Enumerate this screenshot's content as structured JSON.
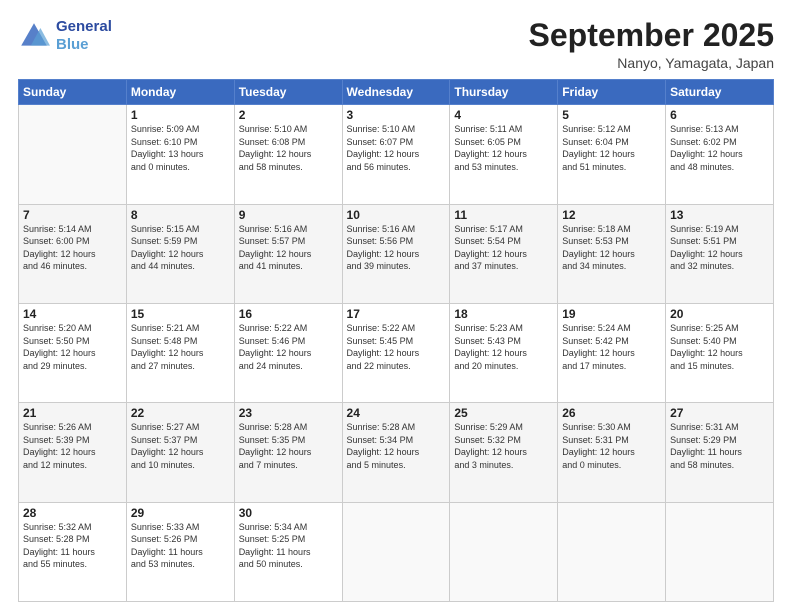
{
  "header": {
    "logo_line1": "General",
    "logo_line2": "Blue",
    "month": "September 2025",
    "location": "Nanyo, Yamagata, Japan"
  },
  "weekdays": [
    "Sunday",
    "Monday",
    "Tuesday",
    "Wednesday",
    "Thursday",
    "Friday",
    "Saturday"
  ],
  "rows": [
    [
      {
        "day": "",
        "info": ""
      },
      {
        "day": "1",
        "info": "Sunrise: 5:09 AM\nSunset: 6:10 PM\nDaylight: 13 hours\nand 0 minutes."
      },
      {
        "day": "2",
        "info": "Sunrise: 5:10 AM\nSunset: 6:08 PM\nDaylight: 12 hours\nand 58 minutes."
      },
      {
        "day": "3",
        "info": "Sunrise: 5:10 AM\nSunset: 6:07 PM\nDaylight: 12 hours\nand 56 minutes."
      },
      {
        "day": "4",
        "info": "Sunrise: 5:11 AM\nSunset: 6:05 PM\nDaylight: 12 hours\nand 53 minutes."
      },
      {
        "day": "5",
        "info": "Sunrise: 5:12 AM\nSunset: 6:04 PM\nDaylight: 12 hours\nand 51 minutes."
      },
      {
        "day": "6",
        "info": "Sunrise: 5:13 AM\nSunset: 6:02 PM\nDaylight: 12 hours\nand 48 minutes."
      }
    ],
    [
      {
        "day": "7",
        "info": "Sunrise: 5:14 AM\nSunset: 6:00 PM\nDaylight: 12 hours\nand 46 minutes."
      },
      {
        "day": "8",
        "info": "Sunrise: 5:15 AM\nSunset: 5:59 PM\nDaylight: 12 hours\nand 44 minutes."
      },
      {
        "day": "9",
        "info": "Sunrise: 5:16 AM\nSunset: 5:57 PM\nDaylight: 12 hours\nand 41 minutes."
      },
      {
        "day": "10",
        "info": "Sunrise: 5:16 AM\nSunset: 5:56 PM\nDaylight: 12 hours\nand 39 minutes."
      },
      {
        "day": "11",
        "info": "Sunrise: 5:17 AM\nSunset: 5:54 PM\nDaylight: 12 hours\nand 37 minutes."
      },
      {
        "day": "12",
        "info": "Sunrise: 5:18 AM\nSunset: 5:53 PM\nDaylight: 12 hours\nand 34 minutes."
      },
      {
        "day": "13",
        "info": "Sunrise: 5:19 AM\nSunset: 5:51 PM\nDaylight: 12 hours\nand 32 minutes."
      }
    ],
    [
      {
        "day": "14",
        "info": "Sunrise: 5:20 AM\nSunset: 5:50 PM\nDaylight: 12 hours\nand 29 minutes."
      },
      {
        "day": "15",
        "info": "Sunrise: 5:21 AM\nSunset: 5:48 PM\nDaylight: 12 hours\nand 27 minutes."
      },
      {
        "day": "16",
        "info": "Sunrise: 5:22 AM\nSunset: 5:46 PM\nDaylight: 12 hours\nand 24 minutes."
      },
      {
        "day": "17",
        "info": "Sunrise: 5:22 AM\nSunset: 5:45 PM\nDaylight: 12 hours\nand 22 minutes."
      },
      {
        "day": "18",
        "info": "Sunrise: 5:23 AM\nSunset: 5:43 PM\nDaylight: 12 hours\nand 20 minutes."
      },
      {
        "day": "19",
        "info": "Sunrise: 5:24 AM\nSunset: 5:42 PM\nDaylight: 12 hours\nand 17 minutes."
      },
      {
        "day": "20",
        "info": "Sunrise: 5:25 AM\nSunset: 5:40 PM\nDaylight: 12 hours\nand 15 minutes."
      }
    ],
    [
      {
        "day": "21",
        "info": "Sunrise: 5:26 AM\nSunset: 5:39 PM\nDaylight: 12 hours\nand 12 minutes."
      },
      {
        "day": "22",
        "info": "Sunrise: 5:27 AM\nSunset: 5:37 PM\nDaylight: 12 hours\nand 10 minutes."
      },
      {
        "day": "23",
        "info": "Sunrise: 5:28 AM\nSunset: 5:35 PM\nDaylight: 12 hours\nand 7 minutes."
      },
      {
        "day": "24",
        "info": "Sunrise: 5:28 AM\nSunset: 5:34 PM\nDaylight: 12 hours\nand 5 minutes."
      },
      {
        "day": "25",
        "info": "Sunrise: 5:29 AM\nSunset: 5:32 PM\nDaylight: 12 hours\nand 3 minutes."
      },
      {
        "day": "26",
        "info": "Sunrise: 5:30 AM\nSunset: 5:31 PM\nDaylight: 12 hours\nand 0 minutes."
      },
      {
        "day": "27",
        "info": "Sunrise: 5:31 AM\nSunset: 5:29 PM\nDaylight: 11 hours\nand 58 minutes."
      }
    ],
    [
      {
        "day": "28",
        "info": "Sunrise: 5:32 AM\nSunset: 5:28 PM\nDaylight: 11 hours\nand 55 minutes."
      },
      {
        "day": "29",
        "info": "Sunrise: 5:33 AM\nSunset: 5:26 PM\nDaylight: 11 hours\nand 53 minutes."
      },
      {
        "day": "30",
        "info": "Sunrise: 5:34 AM\nSunset: 5:25 PM\nDaylight: 11 hours\nand 50 minutes."
      },
      {
        "day": "",
        "info": ""
      },
      {
        "day": "",
        "info": ""
      },
      {
        "day": "",
        "info": ""
      },
      {
        "day": "",
        "info": ""
      }
    ]
  ]
}
